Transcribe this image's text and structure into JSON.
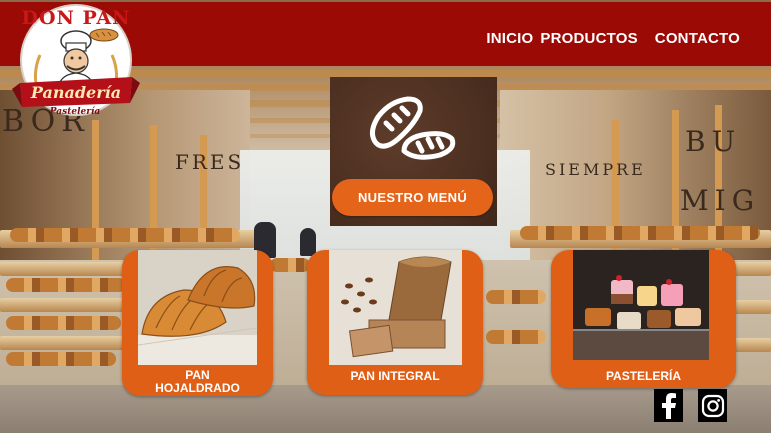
{
  "brand": {
    "name": "DON PAN",
    "ribbon": "Panadería",
    "tagline": "Pastelería"
  },
  "nav": {
    "items": [
      "INICIO",
      "PRODUCTOS",
      "CONTACTO"
    ]
  },
  "menu": {
    "button_label": "NUESTRO MENÚ",
    "icon": "bread-loaves-icon"
  },
  "products": [
    {
      "label_line1": "PAN",
      "label_line2": "HOJALDRADO",
      "image": "croissants"
    },
    {
      "label_line1": "PAN INTEGRAL",
      "label_line2": "",
      "image": "whole-wheat-loaf"
    },
    {
      "label_line1": "PASTELERÍA",
      "label_line2": "",
      "image": "pastries"
    }
  ],
  "social": {
    "icons": [
      "facebook-icon",
      "instagram-icon"
    ]
  },
  "colors": {
    "header": "#9c0a05",
    "accent_orange": "#e4641a",
    "card_orange": "#e05f17",
    "menu_card_brown": "#4a2e20"
  }
}
